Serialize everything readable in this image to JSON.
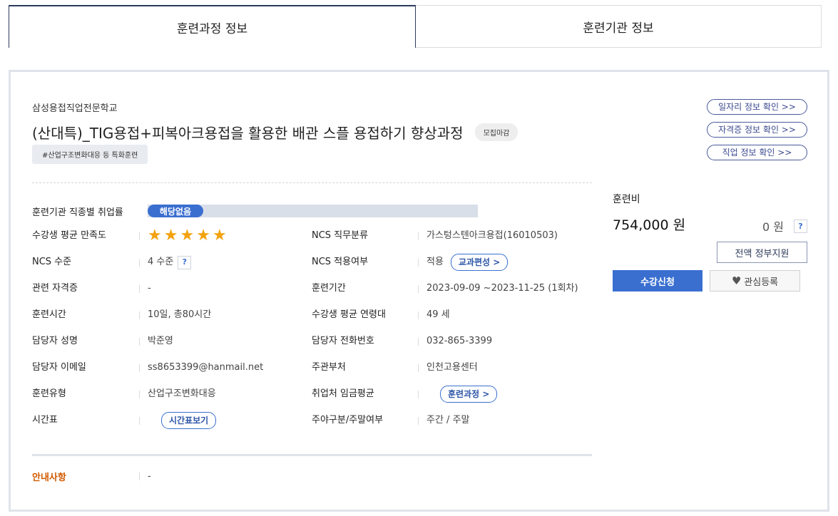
{
  "tabs": [
    {
      "label": "훈련과정 정보",
      "active": true
    },
    {
      "label": "훈련기관 정보",
      "active": false
    }
  ],
  "course": {
    "school": "삼성용접직업전문학교",
    "title": "(산대특)_TIG용접+피복아크용접을 활용한 배관 스플 용접하기 향상과정",
    "status_badge": "모집마감",
    "tag": "#산업구조변화대응 등 특화훈련"
  },
  "links": [
    "일자리 정보 확인 >>",
    "자격증 정보 확인 >>",
    "직업 정보 확인 >>"
  ],
  "employment_rate": {
    "label": "훈련기관 직종별 취업률",
    "value": "해당없음"
  },
  "satisfaction": {
    "label": "수강생 평균 만족도",
    "stars": 5
  },
  "info": {
    "ncs_job_label": "NCS 직무분류",
    "ncs_job_value": "가스텅스텐아크용접(16010503)",
    "ncs_level_label": "NCS 수준",
    "ncs_level_value": "4 수준",
    "help_icon": "?",
    "ncs_apply_label": "NCS 적용여부",
    "ncs_apply_value": "적용",
    "curriculum_btn": "교과편성 >",
    "cert_label": "관련 자격증",
    "cert_value": "-",
    "period_label": "훈련기간",
    "period_value": "2023-09-09 ~2023-11-25 (1회차)",
    "hours_label": "훈련시간",
    "hours_value": "10일, 총80시간",
    "age_label": "수강생 평균 연령대",
    "age_value": "49 세",
    "manager_label": "담당자 성명",
    "manager_value": "박준영",
    "phone_label": "담당자 전화번호",
    "phone_value": "032-865-3399",
    "email_label": "담당자 이메일",
    "email_value": "ss8653399@hanmail.net",
    "dept_label": "주관부처",
    "dept_value": "인천고용센터",
    "type_label": "훈련유형",
    "type_value": "산업구조변화대응",
    "wage_label": "취업처 임금평균",
    "wage_btn": "훈련과정 >",
    "timetable_label": "시간표",
    "timetable_btn": "시간표보기",
    "daynight_label": "주야구분/주말여부",
    "daynight_value": "주간 / 주말"
  },
  "notice": {
    "label": "안내사항",
    "value": "-"
  },
  "fee": {
    "label": "훈련비",
    "amount": "754,000 원",
    "gov_amount": "0 원",
    "help_icon": "?",
    "gov_button": "전액 정부지원",
    "apply_button": "수강신청",
    "wish_button": "관심등록"
  },
  "colors": {
    "accent": "#3a6fd0",
    "star": "#f2a20c",
    "notice": "#d15a00",
    "link_border": "#4a5a9c"
  }
}
